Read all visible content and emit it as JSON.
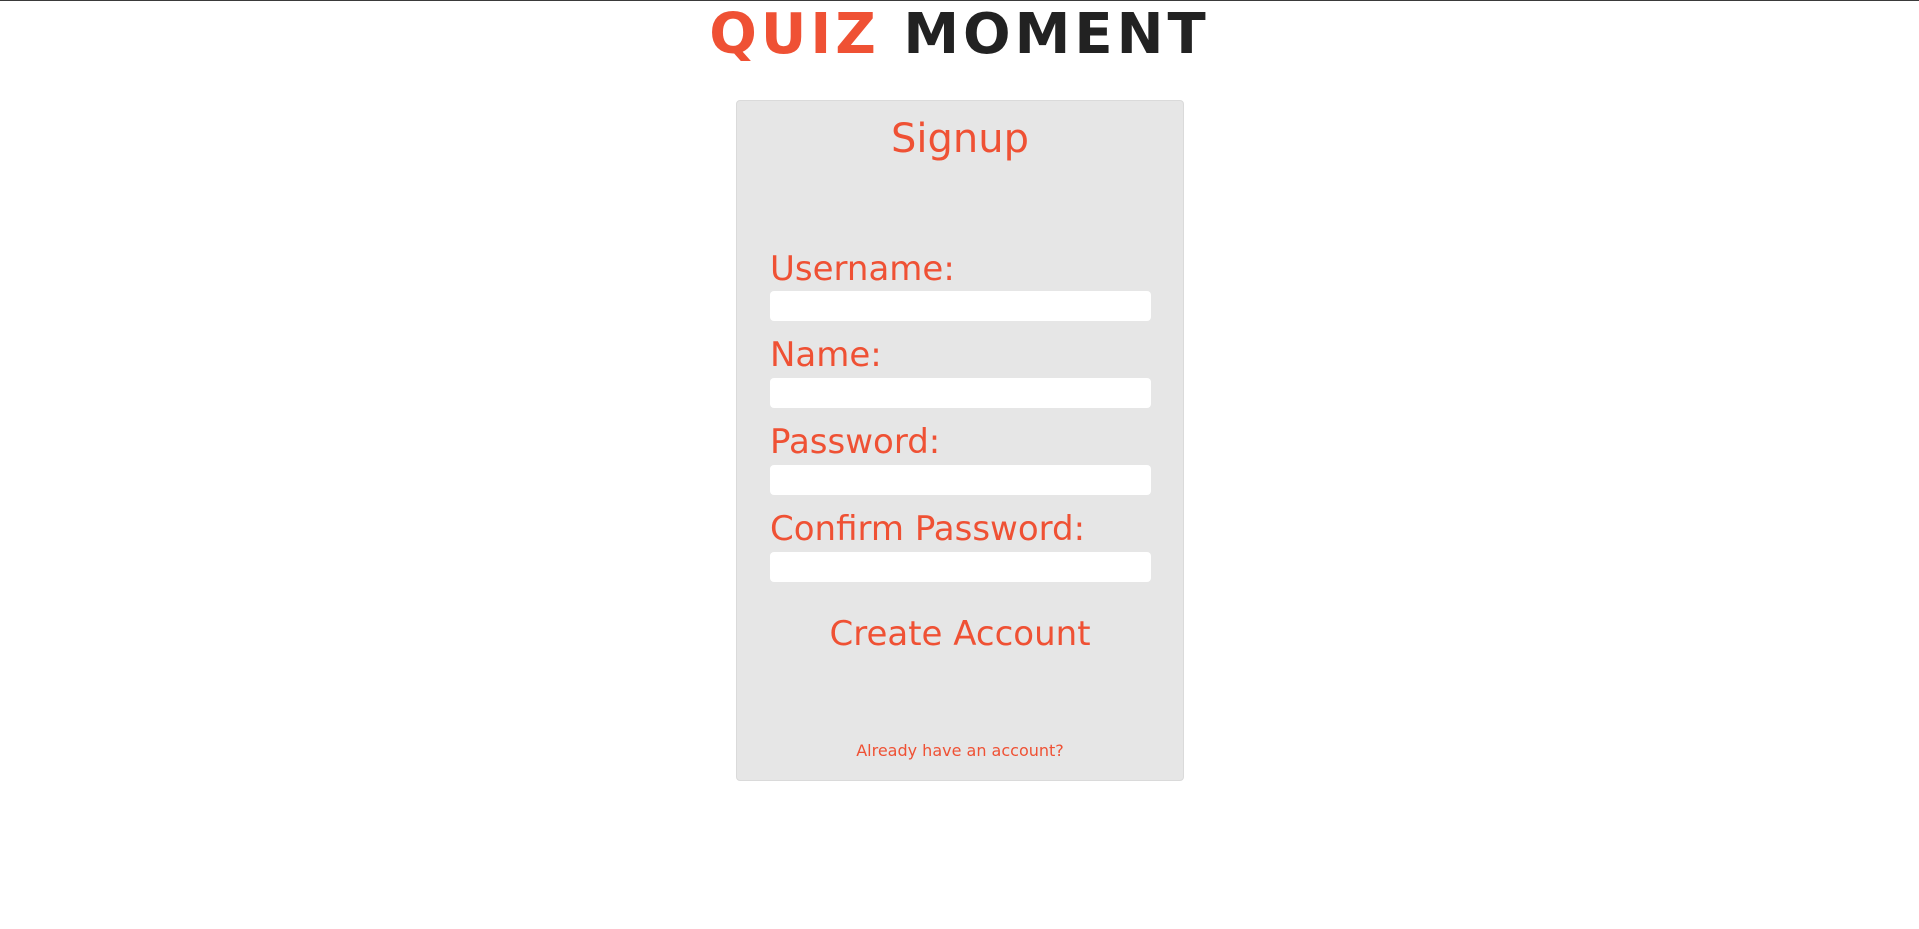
{
  "header": {
    "title_part1": "QUIZ",
    "title_part2": "MOMENT"
  },
  "signup": {
    "title": "Signup",
    "fields": [
      {
        "label": "Username:",
        "value": ""
      },
      {
        "label": "Name:",
        "value": ""
      },
      {
        "label": "Password:",
        "value": ""
      },
      {
        "label": "Confirm Password:",
        "value": ""
      }
    ],
    "submit_label": "Create Account",
    "login_link": "Already have an account?"
  },
  "colors": {
    "accent": "#ef5134",
    "title_dark": "#222222",
    "card_background": "#e6e6e6",
    "input_background": "#ffffff",
    "page_background": "#ffffff"
  }
}
